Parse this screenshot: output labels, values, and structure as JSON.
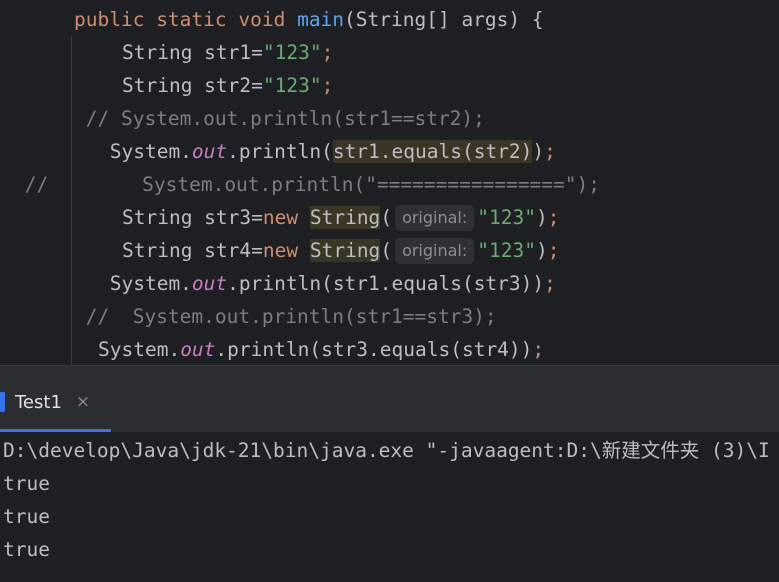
{
  "editor": {
    "lines": [
      {
        "indent": "   ",
        "segments": [
          {
            "t": "public ",
            "c": "kw"
          },
          {
            "t": "static ",
            "c": "kw"
          },
          {
            "t": "void ",
            "c": "kw"
          },
          {
            "t": "main",
            "c": "fn"
          },
          {
            "t": "(String[] args) {",
            "c": ""
          }
        ]
      },
      {
        "indent": "     ",
        "segments": [
          {
            "t": "String str1=",
            "c": ""
          },
          {
            "t": "\"123\"",
            "c": "str"
          },
          {
            "t": ";",
            "c": "kw"
          }
        ]
      },
      {
        "indent": "     ",
        "segments": [
          {
            "t": "String str2=",
            "c": ""
          },
          {
            "t": "\"123\"",
            "c": "str"
          },
          {
            "t": ";",
            "c": "kw"
          }
        ]
      },
      {
        "indent": "   ",
        "segments": [
          {
            "t": " // System.out.println(str1==str2);",
            "c": "cmt"
          }
        ]
      },
      {
        "indent": "    ",
        "segments": [
          {
            "t": " System.",
            "c": ""
          },
          {
            "t": "out",
            "c": "fld"
          },
          {
            "t": ".println(",
            "c": ""
          },
          {
            "t": "str1.equals(str2)",
            "c": "hl"
          },
          {
            "t": ")",
            "c": ""
          },
          {
            "t": ";",
            "c": "kw"
          }
        ]
      },
      {
        "indent": "",
        "segments": [
          {
            "t": " //        System.out.println(\"================\");",
            "c": "cmt"
          }
        ]
      },
      {
        "indent": "     ",
        "segments": [
          {
            "t": "String str3=",
            "c": ""
          },
          {
            "t": "new ",
            "c": "kw"
          },
          {
            "t": "String",
            "c": "hl"
          },
          {
            "t": "(",
            "c": ""
          },
          {
            "hint": "original:"
          },
          {
            "t": "\"123\"",
            "c": "str"
          },
          {
            "t": ")",
            "c": ""
          },
          {
            "t": ";",
            "c": "kw"
          }
        ]
      },
      {
        "indent": "     ",
        "segments": [
          {
            "t": "String str4=",
            "c": ""
          },
          {
            "t": "new ",
            "c": "kw"
          },
          {
            "t": "String",
            "c": "hl"
          },
          {
            "t": "(",
            "c": ""
          },
          {
            "hint": "original:"
          },
          {
            "t": "\"123\"",
            "c": "str"
          },
          {
            "t": ")",
            "c": ""
          },
          {
            "t": ";",
            "c": "kw"
          }
        ]
      },
      {
        "indent": "    ",
        "segments": [
          {
            "t": " System.",
            "c": ""
          },
          {
            "t": "out",
            "c": "fld"
          },
          {
            "t": ".println(str1.equals(str3))",
            "c": ""
          },
          {
            "t": ";",
            "c": "kw"
          }
        ]
      },
      {
        "indent": "   ",
        "segments": [
          {
            "t": " //  System.out.println(str1==str3);",
            "c": "cmt"
          }
        ]
      },
      {
        "indent": "    ",
        "segments": [
          {
            "t": "System.",
            "c": ""
          },
          {
            "t": "out",
            "c": "fld"
          },
          {
            "t": ".println(str3.equals(str4))",
            "c": ""
          },
          {
            "t": ";",
            "c": "kw"
          }
        ]
      }
    ]
  },
  "run_panel": {
    "tab_label": "Test1",
    "close_glyph": "×"
  },
  "console": {
    "lines": [
      "D:\\develop\\Java\\jdk-21\\bin\\java.exe \"-javaagent:D:\\新建文件夹 (3)\\I",
      "true",
      "true",
      "true"
    ]
  },
  "colors": {
    "keyword": "#cf8e6d",
    "string": "#6aab73",
    "comment": "#7a7e85",
    "field": "#c77dbb",
    "method": "#56a8f5",
    "accent": "#3574f0"
  }
}
